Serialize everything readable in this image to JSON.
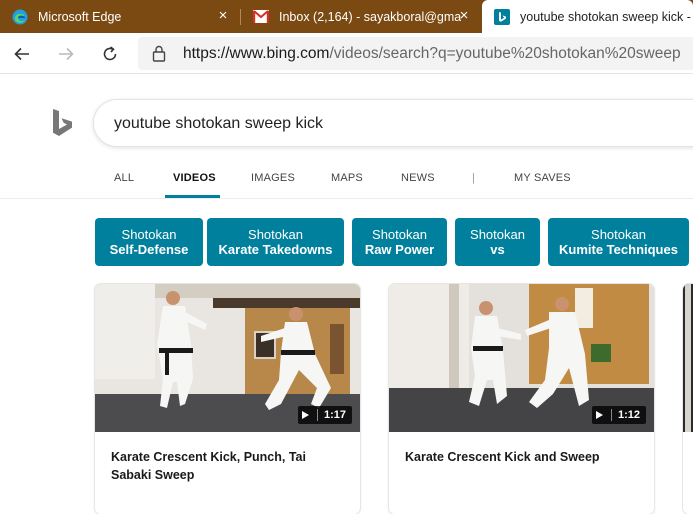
{
  "browser": {
    "tabs": [
      {
        "label": "Microsoft Edge",
        "icon": "edge-icon"
      },
      {
        "label": "Inbox (2,164) - sayakboral@gma",
        "icon": "gmail-icon"
      },
      {
        "label": "youtube shotokan sweep kick -",
        "icon": "bing-icon"
      }
    ],
    "close_glyph": "×",
    "url_host": "https://www.bing.com",
    "url_path": "/videos/search?q=youtube%20shotokan%20sweep"
  },
  "search": {
    "query": "youtube shotokan sweep kick"
  },
  "scopes": {
    "items": [
      "ALL",
      "VIDEOS",
      "IMAGES",
      "MAPS",
      "NEWS",
      "|",
      "MY SAVES"
    ],
    "active": "VIDEOS"
  },
  "related": [
    {
      "line1": "Shotokan",
      "line2": "Self-Defense"
    },
    {
      "line1": "Shotokan",
      "line2": "Karate Takedowns"
    },
    {
      "line1": "Shotokan",
      "line2": "Raw Power"
    },
    {
      "line1": "Shotokan",
      "line2": "vs"
    },
    {
      "line1": "Shotokan",
      "line2": "Kumite Techniques"
    }
  ],
  "videos": [
    {
      "title": "Karate Crescent Kick, Punch, Tai Sabaki Sweep",
      "duration": "1:17"
    },
    {
      "title": "Karate Crescent Kick and Sweep",
      "duration": "1:12"
    }
  ],
  "colors": {
    "tabstrip": "#7a4a12",
    "accent": "#00809d"
  }
}
